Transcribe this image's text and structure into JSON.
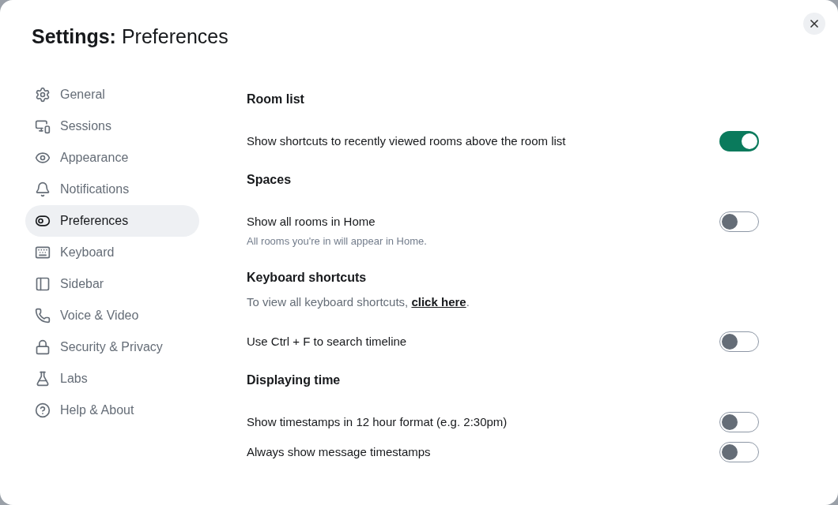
{
  "dialog": {
    "title": "**Settings:** Preferences"
  },
  "sidebar": {
    "items": [
      {
        "label": "General",
        "selected": false
      },
      {
        "label": "Sessions",
        "selected": false
      },
      {
        "label": "Appearance",
        "selected": false
      },
      {
        "label": "Notifications",
        "selected": false
      },
      {
        "label": "Preferences",
        "selected": true
      },
      {
        "label": "Keyboard",
        "selected": false
      },
      {
        "label": "Sidebar",
        "selected": false
      },
      {
        "label": "Voice & Video",
        "selected": false
      },
      {
        "label": "Security & Privacy",
        "selected": false
      },
      {
        "label": "Labs",
        "selected": false
      },
      {
        "label": "Help & About",
        "selected": false
      }
    ]
  },
  "sections": [
    {
      "heading": "Room list",
      "items": [
        {
          "label": "Show shortcuts to recently viewed rooms above the room list",
          "on": true
        }
      ]
    },
    {
      "heading": "Spaces",
      "items": [
        {
          "label": "Show all rooms in Home",
          "description": "All rooms you're in will appear in Home.",
          "on": false
        }
      ]
    },
    {
      "heading": "Keyboard shortcuts",
      "note": {
        "before": "To view all keyboard shortcuts,",
        "link": "click here",
        "after": "."
      },
      "items": [
        {
          "label": "Use Ctrl + F to search timeline",
          "on": false
        }
      ]
    },
    {
      "heading": "Displaying time",
      "items": [
        {
          "label": "Show timestamps in 12 hour format (e.g. 2:30pm)",
          "on": false
        },
        {
          "label": "Always show message timestamps",
          "on": false
        }
      ]
    }
  ]
}
